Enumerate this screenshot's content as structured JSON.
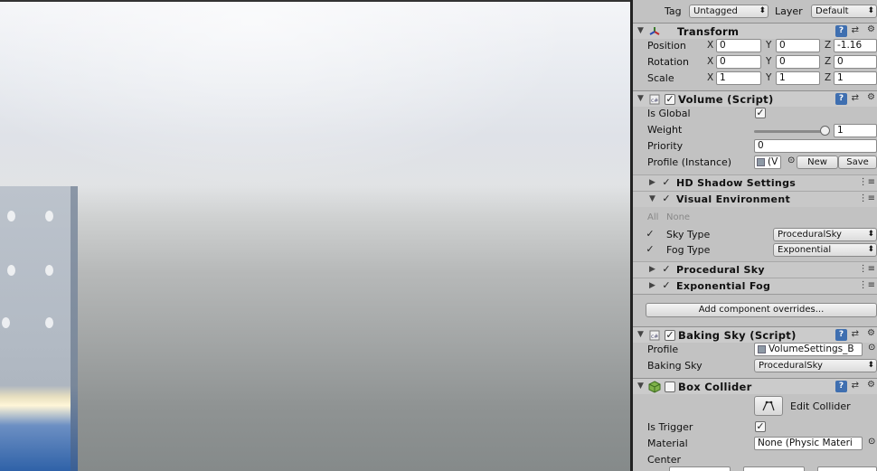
{
  "top": {
    "tag_label": "Tag",
    "tag_value": "Untagged",
    "layer_label": "Layer",
    "layer_value": "Default"
  },
  "transform": {
    "title": "Transform",
    "position": {
      "label": "Position",
      "x": "0",
      "y": "0",
      "z": "-1.16"
    },
    "rotation": {
      "label": "Rotation",
      "x": "0",
      "y": "0",
      "z": "0"
    },
    "scale": {
      "label": "Scale",
      "x": "1",
      "y": "1",
      "z": "1"
    },
    "axes": {
      "x": "X",
      "y": "Y",
      "z": "Z"
    }
  },
  "volume": {
    "title": "Volume (Script)",
    "is_global_label": "Is Global",
    "weight_label": "Weight",
    "weight_value": "1",
    "weight_fraction": 1,
    "priority_label": "Priority",
    "priority_value": "0",
    "profile_label": "Profile (Instance)",
    "profile_value": "(V",
    "new_label": "New",
    "save_label": "Save"
  },
  "overrides": {
    "hd_shadow": "HD Shadow Settings",
    "visual_env": "Visual Environment",
    "all": "All",
    "none": "None",
    "sky_type_label": "Sky Type",
    "sky_type_value": "ProceduralSky",
    "fog_type_label": "Fog Type",
    "fog_type_value": "Exponential",
    "procedural_sky": "Procedural Sky",
    "exponential_fog": "Exponential Fog",
    "add_button": "Add component overrides..."
  },
  "baking": {
    "title": "Baking Sky (Script)",
    "profile_label": "Profile",
    "profile_value": "VolumeSettings_B",
    "baking_sky_label": "Baking Sky",
    "baking_sky_value": "ProceduralSky"
  },
  "collider": {
    "title": "Box Collider",
    "edit_label": "Edit Collider",
    "is_trigger_label": "Is Trigger",
    "material_label": "Material",
    "material_value": "None (Physic Materi",
    "center_label": "Center"
  },
  "colors": {
    "panel": "#c2c2c2",
    "help": "#3f6fb0"
  }
}
